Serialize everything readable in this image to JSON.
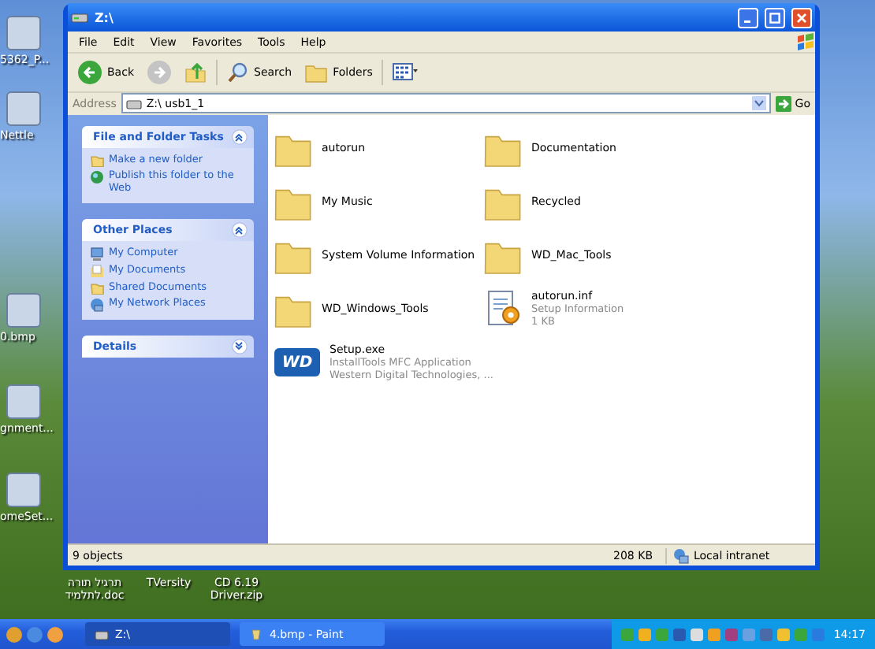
{
  "desktop_icons_left": [
    {
      "label": "5362_P..."
    },
    {
      "label": "Nettle"
    },
    {
      "label": "0.bmp"
    },
    {
      "label": "gnment..."
    },
    {
      "label": "omeSet..."
    }
  ],
  "desktop_icons_bottom": [
    {
      "label": "תרגיל תורה לתלמיד.doc"
    },
    {
      "label": "TVersity"
    },
    {
      "label": "CD 6.19 Driver.zip"
    }
  ],
  "window": {
    "title": "Z:\\",
    "menu": [
      "File",
      "Edit",
      "View",
      "Favorites",
      "Tools",
      "Help"
    ],
    "toolbar": [
      {
        "kind": "back",
        "label": "Back"
      },
      {
        "kind": "forward"
      },
      {
        "kind": "up"
      },
      {
        "kind": "search",
        "label": "Search"
      },
      {
        "kind": "folders",
        "label": "Folders"
      },
      {
        "kind": "views"
      }
    ],
    "address": {
      "label": "Address",
      "value": "Z:\\ usb1_1",
      "go": "Go"
    },
    "task_panels": [
      {
        "title": "File and Folder Tasks",
        "expanded": true,
        "items": [
          {
            "label": "Make a new folder",
            "kind": "folder"
          },
          {
            "label": "Publish this folder to the Web",
            "kind": "globe"
          }
        ]
      },
      {
        "title": "Other Places",
        "expanded": true,
        "items": [
          {
            "label": "My Computer",
            "kind": "computer"
          },
          {
            "label": "My Documents",
            "kind": "documents"
          },
          {
            "label": "Shared Documents",
            "kind": "folder"
          },
          {
            "label": "My Network Places",
            "kind": "network"
          }
        ]
      },
      {
        "title": "Details",
        "expanded": false
      }
    ],
    "files": [
      {
        "name": "autorun",
        "kind": "folder"
      },
      {
        "name": "Documentation",
        "kind": "folder"
      },
      {
        "name": "My Music",
        "kind": "folder"
      },
      {
        "name": "Recycled",
        "kind": "folder"
      },
      {
        "name": "System Volume Information",
        "kind": "folder"
      },
      {
        "name": "WD_Mac_Tools",
        "kind": "folder"
      },
      {
        "name": "WD_Windows_Tools",
        "kind": "folder"
      },
      {
        "name": "autorun.inf",
        "kind": "inf",
        "details": [
          "Setup Information",
          "1 KB"
        ]
      },
      {
        "name": "Setup.exe",
        "kind": "exe",
        "logo": "WD",
        "details": [
          "InstallTools MFC Application",
          "Western Digital Technologies, ..."
        ]
      }
    ],
    "status_bar": {
      "objects": "9 objects",
      "size": "208 KB",
      "zone": "Local intranet"
    }
  },
  "taskbar": {
    "buttons": [
      {
        "label": "Z:\\",
        "selected": true
      },
      {
        "label": "4.bmp - Paint",
        "selected": false
      }
    ],
    "clock": "14:17"
  }
}
